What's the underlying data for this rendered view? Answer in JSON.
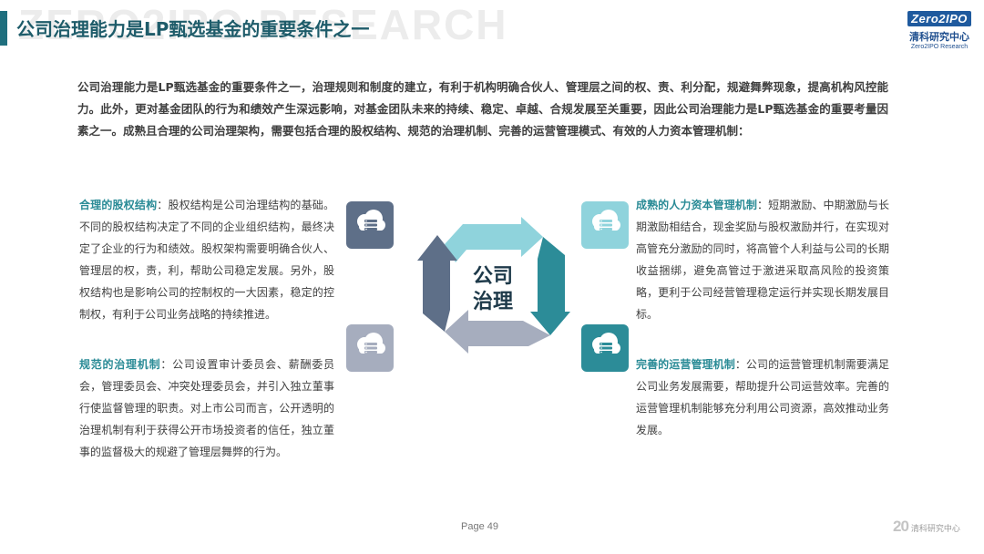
{
  "header": {
    "watermark": "ZERO2IPO RESEARCH",
    "title": "公司治理能力是LP甄选基金的重要条件之一"
  },
  "logo": {
    "mark": "Zero2IPO",
    "cn": "清科研究中心",
    "en": "Zero2IPO Research"
  },
  "intro": "公司治理能力是LP甄选基金的重要条件之一，治理规则和制度的建立，有利于机构明确合伙人、管理层之间的权、责、利分配，规避舞弊现象，提高机构风控能力。此外，更对基金团队的行为和绩效产生深远影响，对基金团队未来的持续、稳定、卓越、合规发展至关重要，因此公司治理能力是LP甄选基金的重要考量因素之一。成熟且合理的公司治理架构，需要包括合理的股权结构、规范的治理机制、完善的运营管理模式、有效的人力资本管理机制：",
  "blocks": [
    {
      "head": "合理的股权结构",
      "body": "：股权结构是公司治理结构的基础。不同的股权结构决定了不同的企业组织结构，最终决定了企业的行为和绩效。股权架构需要明确合伙人、管理层的权，责，利，帮助公司稳定发展。另外，股权结构也是影响公司的控制权的一大因素，稳定的控制权，有利于公司业务战略的持续推进。"
    },
    {
      "head": "规范的治理机制",
      "body": "：公司设置审计委员会、薪酬委员会，管理委员会、冲突处理委员会，并引入独立董事行使监督管理的职责。对上市公司而言，公开透明的治理机制有利于获得公开市场投资者的信任，独立董事的监督极大的规避了管理层舞弊的行为。"
    },
    {
      "head": "成熟的人力资本管理机制",
      "body": "：短期激励、中期激励与长期激励相结合，现金奖励与股权激励并行，在实现对高管充分激励的同时，将高管个人利益与公司的长期收益捆绑，避免高管过于激进采取高风险的投资策略，更利于公司经营管理稳定运行并实现长期发展目标。"
    },
    {
      "head": "完善的运营管理机制",
      "body": "：公司的运营管理机制需要满足公司业务发展需要，帮助提升公司运营效率。完善的运营管理机制能够充分利用公司资源，高效推动业务发展。"
    }
  ],
  "center": {
    "line1": "公司",
    "line2": "治理"
  },
  "colors": {
    "accent": "#2a8b96",
    "title": "#1e5c6a",
    "arrow_dark": "#5e6f88",
    "arrow_gray": "#a6adbe",
    "arrow_light": "#8fd3dc",
    "arrow_teal": "#2c8c98"
  },
  "icons": [
    "cloud-server-icon",
    "cloud-server-icon",
    "cloud-server-icon",
    "cloud-server-icon"
  ],
  "footer": {
    "page": "Page  49",
    "logo_num": "20",
    "logo_cn": "清科研究中心"
  }
}
